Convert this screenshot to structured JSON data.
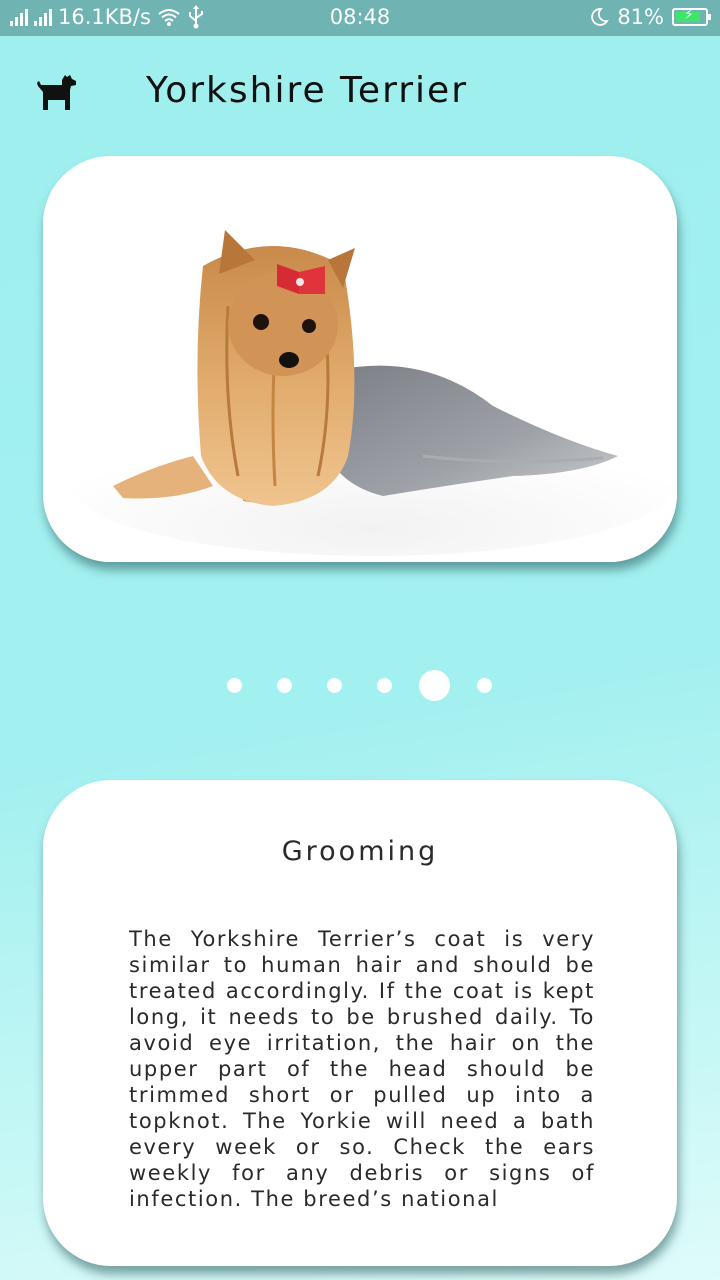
{
  "status_bar": {
    "speed": "16.1KB/s",
    "time": "08:48",
    "battery": "81%",
    "icons": [
      "signal-icon",
      "wifi-icon",
      "usb-icon",
      "moon-icon",
      "battery-charging-icon"
    ]
  },
  "header": {
    "icon": "dog-icon",
    "title": "Yorkshire Terrier"
  },
  "carousel": {
    "dot_count": 6,
    "active_index": 4
  },
  "info": {
    "heading": "Grooming",
    "body": "The Yorkshire Terrier’s coat is very similar to human hair and should be treated accordingly. If the coat is kept long, it needs to be brushed daily. To avoid eye irritation, the hair on the upper part of the head should be trimmed short or pulled up into a topknot. The Yorkie will need a bath every week or so. Check the ears weekly for any debris or signs of infection. The breed’s national"
  },
  "colors": {
    "background": "#a3f0f0",
    "status_bar": "#6fb3b3",
    "card": "#ffffff",
    "battery_fill": "#3fe46b"
  }
}
